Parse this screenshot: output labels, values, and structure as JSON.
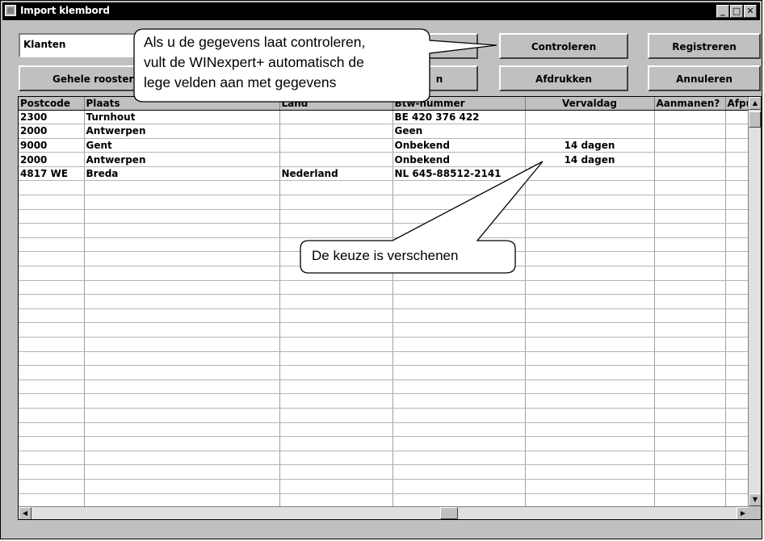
{
  "window": {
    "title": "Import klembord"
  },
  "toolbar": {
    "combo_value": "Klanten",
    "grid_btn": "Gehele rooster",
    "controleren": "Controleren",
    "registreren": "Registreren",
    "afdrukken": "Afdrukken",
    "annuleren": "Annuleren",
    "partial_btn": "n"
  },
  "table": {
    "columns": [
      "Postcode",
      "Plaats",
      "Land",
      "Btw-nummer",
      "Vervaldag",
      "Aanmanen?",
      "Afpu"
    ],
    "rows": [
      [
        "2300",
        "Turnhout",
        "",
        "BE 420 376 422",
        "",
        "",
        ""
      ],
      [
        "2000",
        "Antwerpen",
        "",
        "Geen",
        "",
        "",
        ""
      ],
      [
        "9000",
        "Gent",
        "",
        "Onbekend",
        "14 dagen",
        "",
        ""
      ],
      [
        "2000",
        "Antwerpen",
        "",
        "Onbekend",
        "14 dagen",
        "",
        ""
      ],
      [
        "4817 WE",
        "Breda",
        "Nederland",
        "NL 645-88512-2141",
        "",
        "",
        ""
      ]
    ],
    "empty_rows": 23
  },
  "callouts": {
    "top": "Als u de gegevens laat controleren,\nvult de WINexpert+ automatisch de\nlege velden aan met gegevens",
    "bottom": "De keuze is verschenen"
  }
}
